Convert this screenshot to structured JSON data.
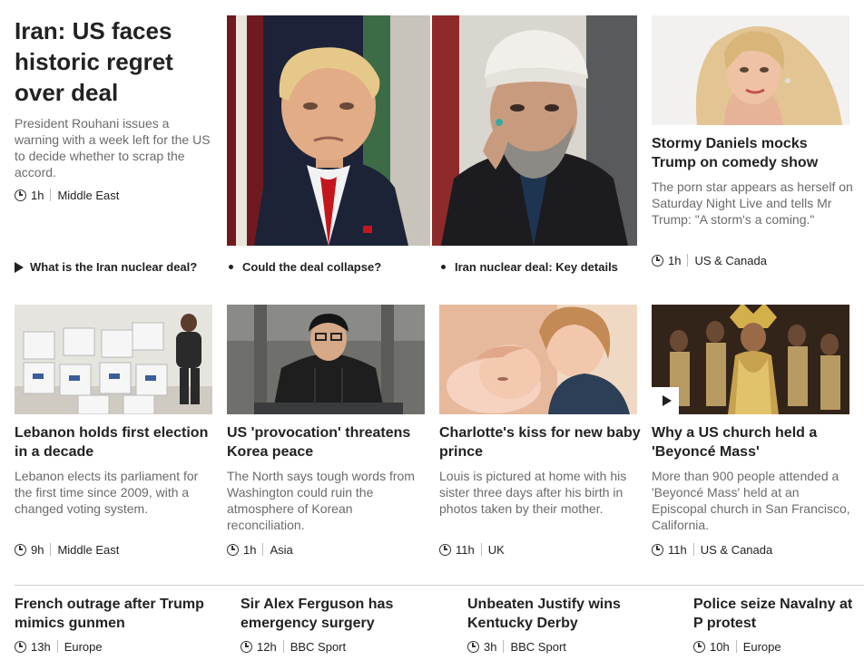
{
  "lead": {
    "title": "Iran: US faces historic regret over deal",
    "summary": "President Rouhani issues a warning with a week left for the US to decide whether to scrap the accord.",
    "time": "1h",
    "section": "Middle East",
    "links": [
      {
        "label": "What is the Iran nuclear deal?",
        "icon": "play-icon"
      },
      {
        "label": "Could the deal collapse?",
        "icon": "bullet"
      },
      {
        "label": "Iran nuclear deal: Key details",
        "icon": "bullet"
      }
    ]
  },
  "top_right": {
    "title": "Stormy Daniels mocks Trump on comedy show",
    "summary": "The porn star appears as herself on Saturday Night Live and tells Mr Trump: \"A storm's a coming.\"",
    "time": "1h",
    "section": "US & Canada"
  },
  "cards": [
    {
      "title": "Lebanon holds first election in a decade",
      "summary": "Lebanon elects its parliament for the first time since 2009, with a changed voting system.",
      "time": "9h",
      "section": "Middle East"
    },
    {
      "title": "US 'provocation' threatens Korea peace",
      "summary": "The North says tough words from Washington could ruin the atmosphere of Korean reconciliation.",
      "time": "1h",
      "section": "Asia"
    },
    {
      "title": "Charlotte's kiss for new baby prince",
      "summary": "Louis is pictured at home with his sister three days after his birth in photos taken by their mother.",
      "time": "11h",
      "section": "UK"
    },
    {
      "title": "Why a US church held a 'Beyoncé Mass'",
      "summary": "More than 900 people attended a 'Beyoncé Mass' held at an Episcopal church in San Francisco, California.",
      "time": "11h",
      "section": "US & Canada",
      "video": true
    }
  ],
  "bottom": [
    {
      "title": "French outrage after Trump mimics gunmen",
      "time": "13h",
      "section": "Europe"
    },
    {
      "title": "Sir Alex Ferguson has emergency surgery",
      "time": "12h",
      "section": "BBC Sport"
    },
    {
      "title": "Unbeaten Justify wins Kentucky Derby",
      "time": "3h",
      "section": "BBC Sport"
    },
    {
      "title": "Police seize Navalny at P protest",
      "time": "10h",
      "section": "Europe"
    }
  ]
}
